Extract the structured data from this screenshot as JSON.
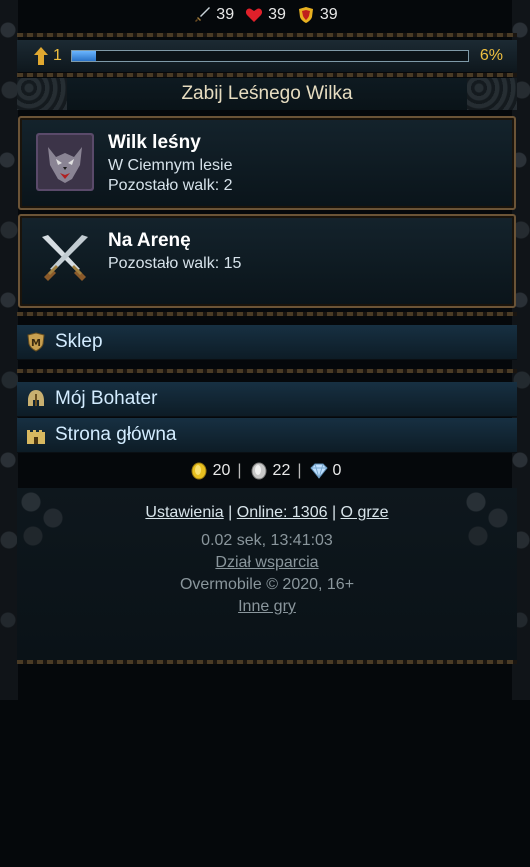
{
  "stats": {
    "attack": "39",
    "health": "39",
    "defense": "39"
  },
  "level": {
    "value": "1",
    "progress_percent_label": "6%",
    "progress_fraction": 0.06
  },
  "quest": {
    "title": "Zabij Leśnego Wilka"
  },
  "cards": [
    {
      "name": "Wilk leśny",
      "lines": [
        "W Ciemnym lesie",
        "Pozostało walk: 2"
      ],
      "icon": "wolf-portrait"
    },
    {
      "name": "Na Arenę",
      "lines": [
        "Pozostało walk: 15"
      ],
      "icon": "crossed-swords"
    }
  ],
  "menu": [
    {
      "label": "Sklep",
      "icon": "shop-shield-icon"
    },
    {
      "label": "Mój Bohater",
      "icon": "helmet-icon"
    },
    {
      "label": "Strona główna",
      "icon": "castle-icon"
    }
  ],
  "currency": {
    "gold": "20",
    "silver": "22",
    "diamonds": "0"
  },
  "footer": {
    "settings": "Ustawienia",
    "online": "Online: 1306",
    "about": "O grze",
    "timing": "0.02 sek, 13:41:03",
    "support": "Dział wsparcia",
    "copyright": "Overmobile © 2020, 16+",
    "other_games": "Inne gry"
  },
  "colors": {
    "accent_gold": "#f0c040",
    "menu_text": "#d3ecff",
    "card_border": "#6b5437"
  }
}
